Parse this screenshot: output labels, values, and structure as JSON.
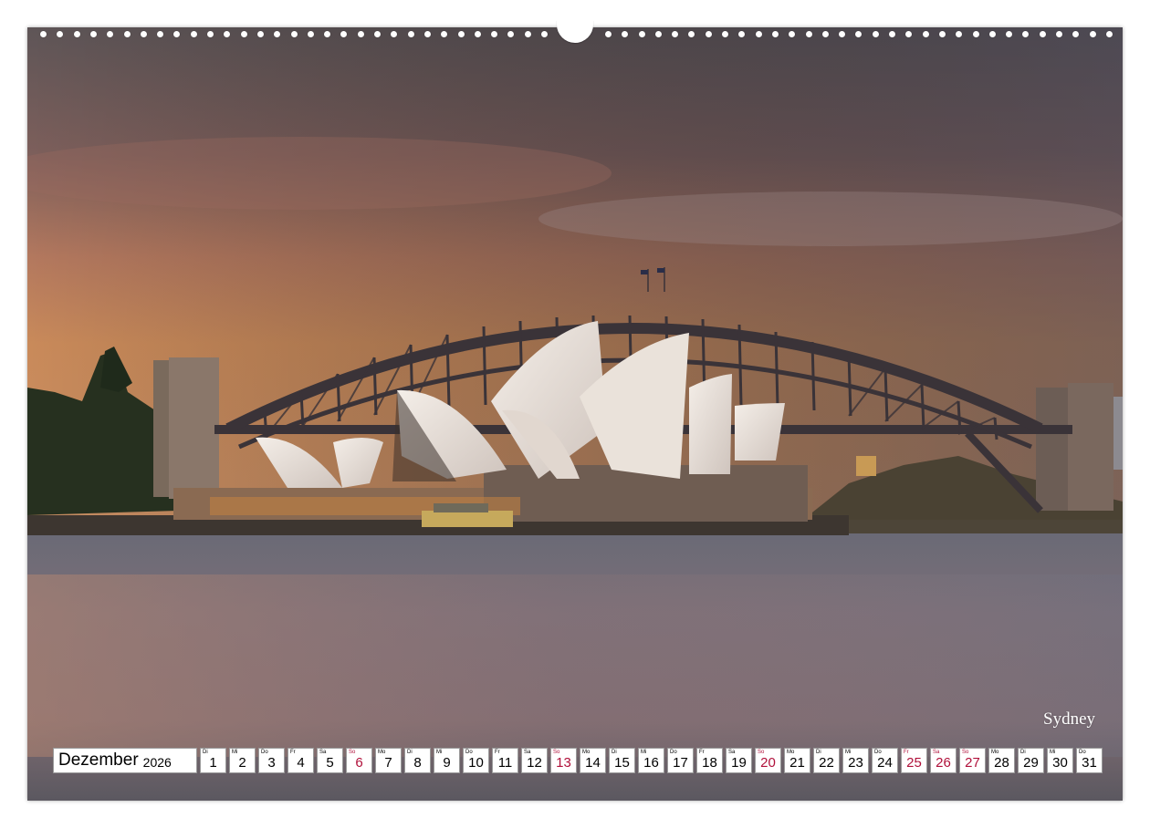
{
  "photo": {
    "location_label": "Sydney"
  },
  "calendar": {
    "month": "Dezember",
    "year": "2026",
    "accent_color": "#b0103a",
    "days": [
      {
        "wd": "Di",
        "num": "1",
        "holiday": false
      },
      {
        "wd": "Mi",
        "num": "2",
        "holiday": false
      },
      {
        "wd": "Do",
        "num": "3",
        "holiday": false
      },
      {
        "wd": "Fr",
        "num": "4",
        "holiday": false
      },
      {
        "wd": "Sa",
        "num": "5",
        "holiday": false
      },
      {
        "wd": "So",
        "num": "6",
        "holiday": true
      },
      {
        "wd": "Mo",
        "num": "7",
        "holiday": false
      },
      {
        "wd": "Di",
        "num": "8",
        "holiday": false
      },
      {
        "wd": "Mi",
        "num": "9",
        "holiday": false
      },
      {
        "wd": "Do",
        "num": "10",
        "holiday": false
      },
      {
        "wd": "Fr",
        "num": "11",
        "holiday": false
      },
      {
        "wd": "Sa",
        "num": "12",
        "holiday": false
      },
      {
        "wd": "So",
        "num": "13",
        "holiday": true
      },
      {
        "wd": "Mo",
        "num": "14",
        "holiday": false
      },
      {
        "wd": "Di",
        "num": "15",
        "holiday": false
      },
      {
        "wd": "Mi",
        "num": "16",
        "holiday": false
      },
      {
        "wd": "Do",
        "num": "17",
        "holiday": false
      },
      {
        "wd": "Fr",
        "num": "18",
        "holiday": false
      },
      {
        "wd": "Sa",
        "num": "19",
        "holiday": false
      },
      {
        "wd": "So",
        "num": "20",
        "holiday": true
      },
      {
        "wd": "Mo",
        "num": "21",
        "holiday": false
      },
      {
        "wd": "Di",
        "num": "22",
        "holiday": false
      },
      {
        "wd": "Mi",
        "num": "23",
        "holiday": false
      },
      {
        "wd": "Do",
        "num": "24",
        "holiday": false
      },
      {
        "wd": "Fr",
        "num": "25",
        "holiday": true
      },
      {
        "wd": "Sa",
        "num": "26",
        "holiday": true
      },
      {
        "wd": "So",
        "num": "27",
        "holiday": true
      },
      {
        "wd": "Mo",
        "num": "28",
        "holiday": false
      },
      {
        "wd": "Di",
        "num": "29",
        "holiday": false
      },
      {
        "wd": "Mi",
        "num": "30",
        "holiday": false
      },
      {
        "wd": "Do",
        "num": "31",
        "holiday": false
      }
    ]
  }
}
